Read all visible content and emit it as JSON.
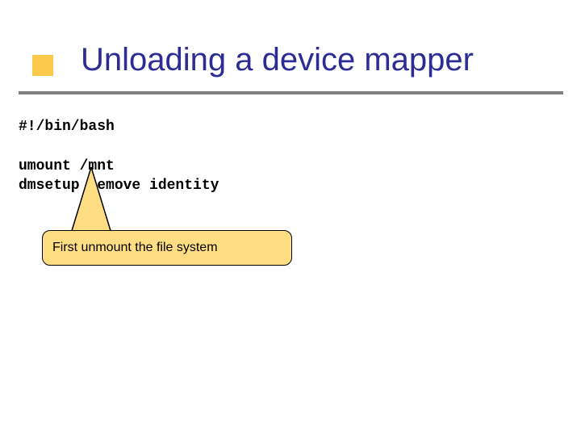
{
  "title": "Unloading a device mapper",
  "code": {
    "shebang": "#!/bin/bash",
    "blank": "",
    "line1": "umount /mnt",
    "line2": "dmsetup remove identity"
  },
  "callout": {
    "text": "First unmount the file system"
  }
}
